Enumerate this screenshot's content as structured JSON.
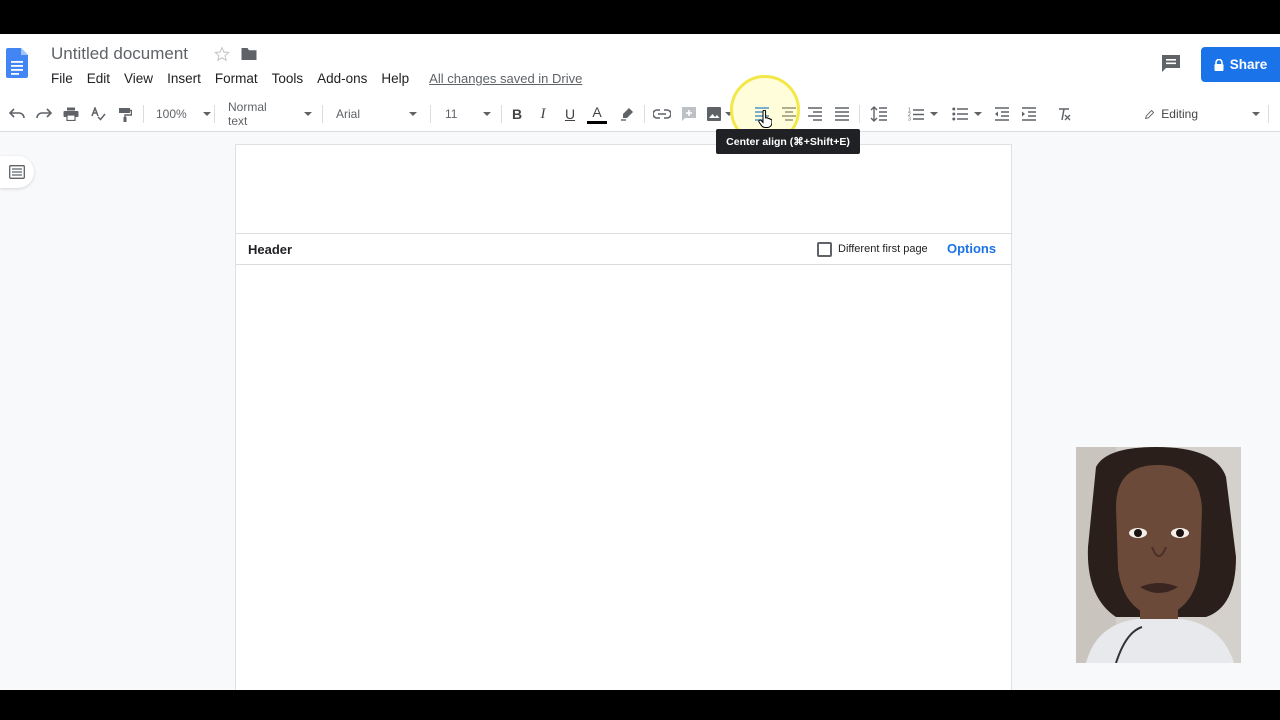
{
  "doc": {
    "title": "Untitled document",
    "save_status": "All changes saved in Drive"
  },
  "menu": [
    "File",
    "Edit",
    "View",
    "Insert",
    "Format",
    "Tools",
    "Add-ons",
    "Help"
  ],
  "share": {
    "label": "Share"
  },
  "toolbar": {
    "zoom": "100%",
    "style": "Normal text",
    "font": "Arial",
    "font_size": "11",
    "mode": "Editing",
    "text_color": "#000000"
  },
  "tooltip": {
    "text": "Center align (⌘+Shift+E)"
  },
  "header_section": {
    "label": "Header",
    "different_first_page": "Different first page",
    "options": "Options"
  },
  "icons": [
    "docs-logo-icon",
    "star-icon",
    "folder-icon",
    "comment-icon",
    "lock-icon",
    "undo-icon",
    "redo-icon",
    "print-icon",
    "spellcheck-icon",
    "paint-format-icon",
    "bold-icon",
    "italic-icon",
    "underline-icon",
    "text-color-icon",
    "highlight-icon",
    "link-icon",
    "add-comment-icon",
    "image-icon",
    "align-left-icon",
    "align-center-icon",
    "align-right-icon",
    "justify-icon",
    "line-spacing-icon",
    "numbered-list-icon",
    "bulleted-list-icon",
    "decrease-indent-icon",
    "increase-indent-icon",
    "clear-formatting-icon",
    "pencil-icon",
    "outline-icon"
  ],
  "colors": {
    "accent": "#1a73e8",
    "tooltip_bg": "#202124",
    "highlight_ring": "#f2e84a"
  }
}
